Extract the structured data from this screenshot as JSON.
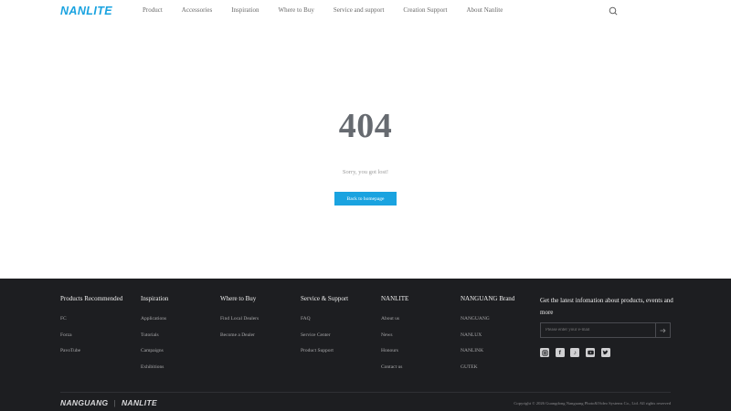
{
  "header": {
    "logo": "NANLITE",
    "nav": [
      "Product",
      "Accessories",
      "Inspiration",
      "Where to Buy",
      "Service and support",
      "Creation Support",
      "About Nanlite"
    ]
  },
  "main": {
    "code": "404",
    "message": "Sorry, you got lost!",
    "button": "Back to homepage"
  },
  "footer": {
    "columns": [
      {
        "title": "Products Recommended",
        "links": [
          "FC",
          "Forza",
          "PavoTube"
        ]
      },
      {
        "title": "Inspiration",
        "links": [
          "Applications",
          "Tutorials",
          "Campaigns",
          "Exhibitions"
        ]
      },
      {
        "title": "Where to Buy",
        "links": [
          "Find Local Dealers",
          "Become a Dealer"
        ]
      },
      {
        "title": "Service & Support",
        "links": [
          "FAQ",
          "Service Center",
          "Product Support"
        ]
      },
      {
        "title": "NANLITE",
        "links": [
          "About us",
          "News",
          "Honours",
          "Contact us"
        ]
      },
      {
        "title": "NANGUANG Brand",
        "links": [
          "NANGUANG",
          "NANLUX",
          "NANLINK",
          "GUTEK"
        ]
      }
    ],
    "newsletter_title": "Get the latest infomation about products, events and more",
    "email_placeholder": "Please enter your e-mail",
    "socials": [
      "instagram-icon",
      "facebook-icon",
      "tiktok-icon",
      "youtube-icon",
      "twitter-icon"
    ],
    "brand_left": "NANGUANG",
    "brand_sep": "|",
    "brand_right": "NANLITE",
    "copyright": "Copyright © 2026 Guangdong Nanguang Photo&Video Systems Co., Ltd. All rights reserved"
  },
  "colors": {
    "accent": "#1aa3e0",
    "footer_bg": "#1d1e21"
  }
}
